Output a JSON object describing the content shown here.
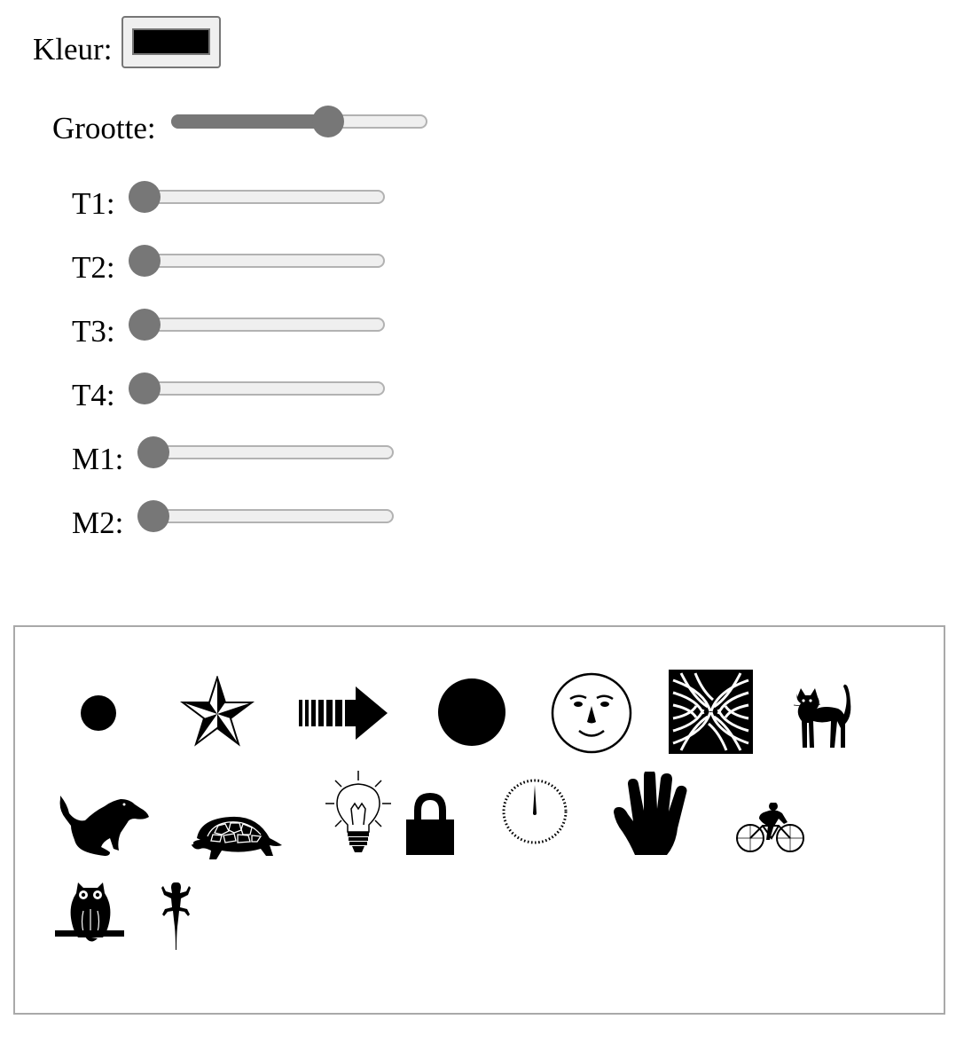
{
  "controls": {
    "color": {
      "label": "Kleur:",
      "value": "#000000"
    },
    "size": {
      "label": "Grootte:",
      "value_fraction": 0.63
    },
    "sliders": [
      {
        "key": "t1",
        "label": "T1:",
        "value_fraction": 0
      },
      {
        "key": "t2",
        "label": "T2:",
        "value_fraction": 0
      },
      {
        "key": "t3",
        "label": "T3:",
        "value_fraction": 0
      },
      {
        "key": "t4",
        "label": "T4:",
        "value_fraction": 0
      },
      {
        "key": "m1",
        "label": "M1:",
        "value_fraction": 0
      },
      {
        "key": "m2",
        "label": "M2:",
        "value_fraction": 0
      }
    ]
  },
  "shapes": [
    "dot-icon",
    "nautical-star-icon",
    "striped-arrow-icon",
    "filled-circle-icon",
    "moon-face-icon",
    "psychedelic-pattern-icon",
    "cat-icon",
    "dog-icon",
    "tortoise-icon",
    "light-bulb-icon",
    "padlock-icon",
    "clock-dial-icon",
    "hand-icon",
    "cyclist-icon",
    "owl-icon",
    "lizard-icon"
  ],
  "theme": {
    "shape_color": "#000000",
    "slider_color": "#777777"
  }
}
